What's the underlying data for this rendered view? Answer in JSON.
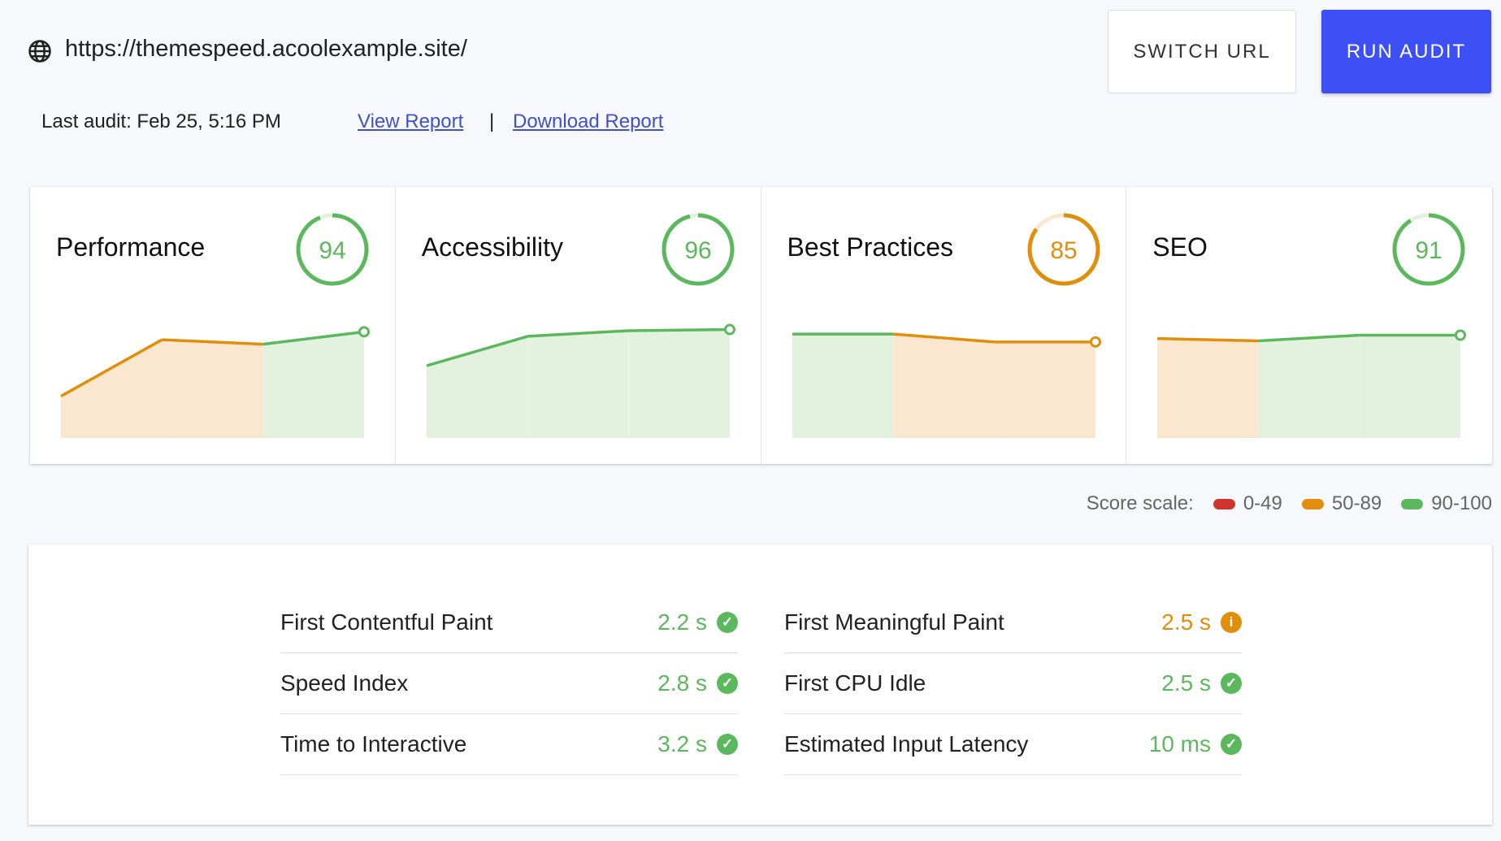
{
  "header": {
    "url": "https://themespeed.acoolexample.site/",
    "switch_url": "SWITCH URL",
    "run_audit": "RUN AUDIT",
    "last_audit": "Last audit: Feb 25, 5:16 PM",
    "view_report": "View Report",
    "separator": "|",
    "download_report": "Download Report"
  },
  "colors": {
    "green": "#5cb85c",
    "orange": "#e08e0b",
    "red": "#d0342c",
    "accent": "#3d50f5",
    "green_fill": "#e3f2df",
    "orange_fill": "#fbe7cf"
  },
  "categories": [
    {
      "title": "Performance",
      "score": "94",
      "history": [
        37,
        87,
        83,
        94
      ]
    },
    {
      "title": "Accessibility",
      "score": "96",
      "history": [
        64,
        90,
        95,
        96
      ]
    },
    {
      "title": "Best Practices",
      "score": "85",
      "history": [
        92,
        92,
        85,
        85
      ]
    },
    {
      "title": "SEO",
      "score": "91",
      "history": [
        88,
        86,
        91,
        91
      ]
    }
  ],
  "score_scale": {
    "label": "Score scale:",
    "ranges": [
      "0-49",
      "50-89",
      "90-100"
    ]
  },
  "metrics": {
    "left": [
      {
        "label": "First Contentful Paint",
        "value": "2.2 s",
        "status": "pass"
      },
      {
        "label": "Speed Index",
        "value": "2.8 s",
        "status": "pass"
      },
      {
        "label": "Time to Interactive",
        "value": "3.2 s",
        "status": "pass"
      }
    ],
    "right": [
      {
        "label": "First Meaningful Paint",
        "value": "2.5 s",
        "status": "average"
      },
      {
        "label": "First CPU Idle",
        "value": "2.5 s",
        "status": "pass"
      },
      {
        "label": "Estimated Input Latency",
        "value": "10 ms",
        "status": "pass"
      }
    ]
  }
}
